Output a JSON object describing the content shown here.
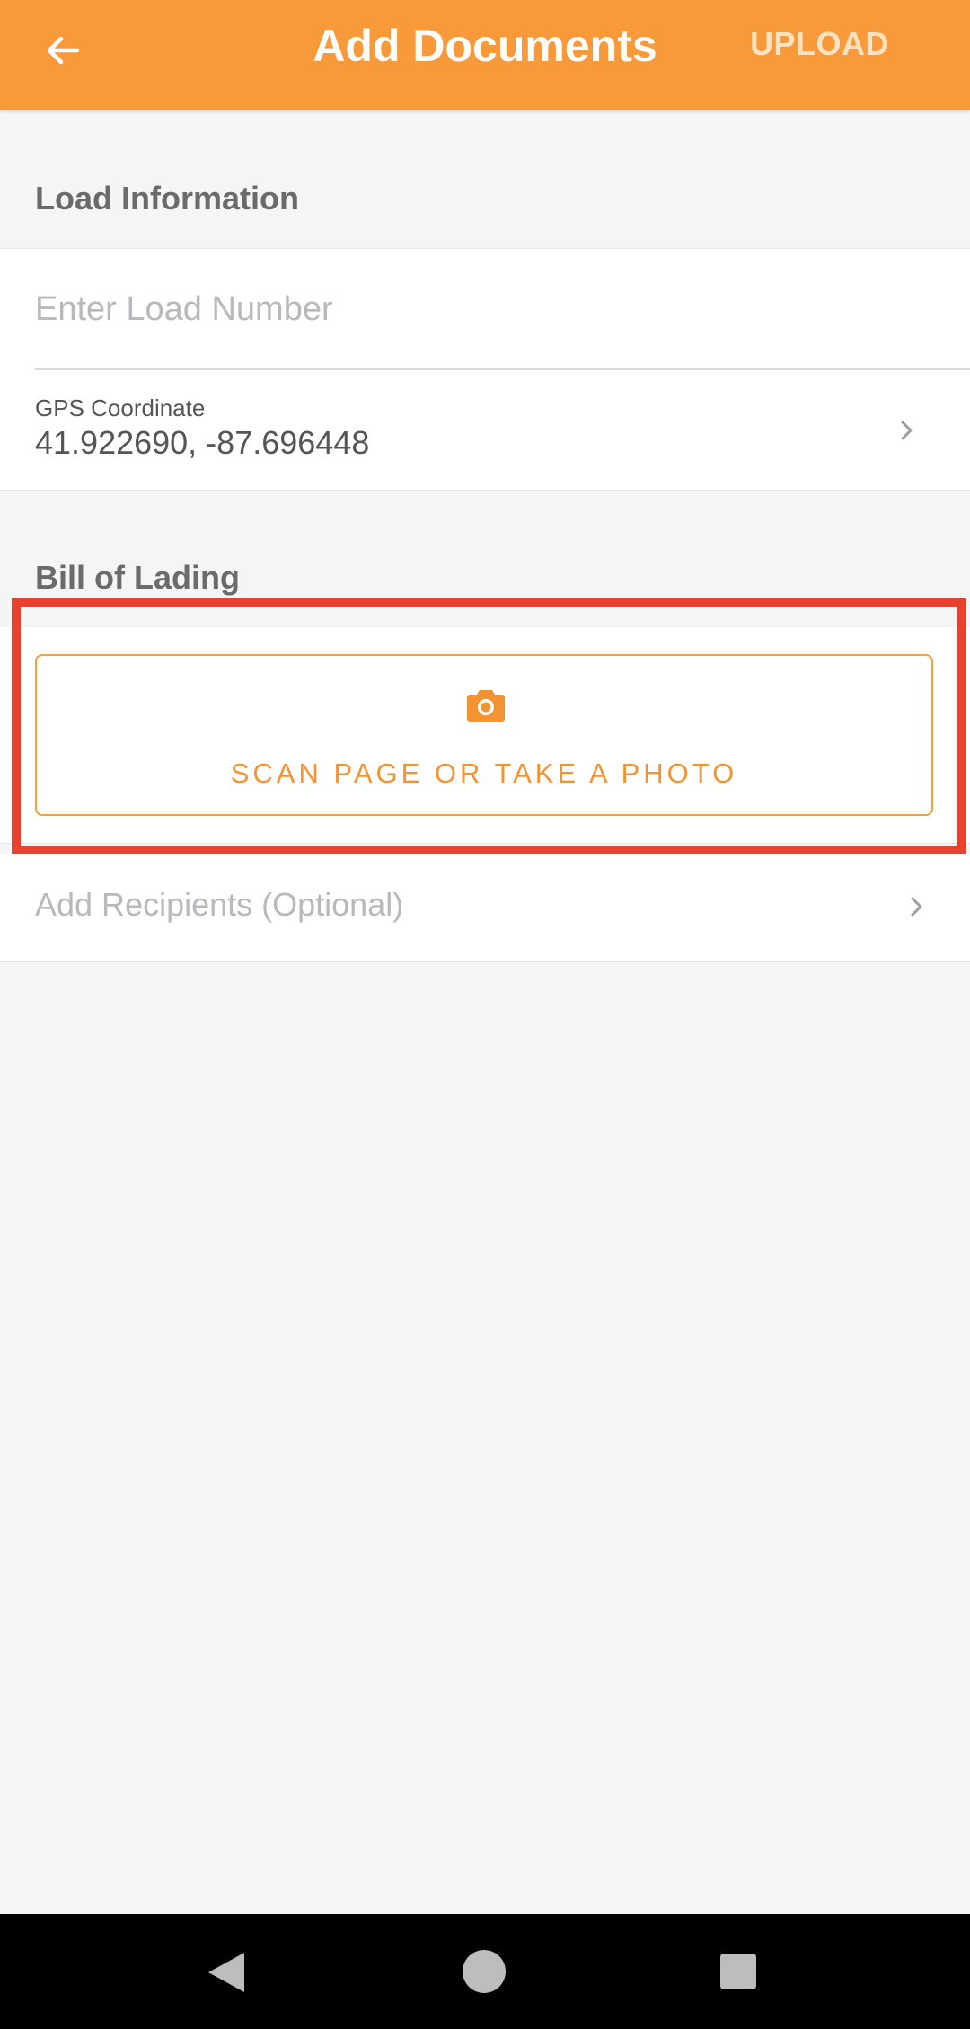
{
  "appbar": {
    "title": "Add Documents",
    "upload_label": "UPLOAD",
    "back_icon": "arrow-left-icon"
  },
  "load_info": {
    "header": "Load Information",
    "load_number_placeholder": "Enter Load Number",
    "load_number_value": "",
    "gps_label": "GPS Coordinate",
    "gps_value": "41.922690, -87.696448"
  },
  "bill_of_lading": {
    "header": "Bill of Lading",
    "scan_label": "SCAN PAGE OR TAKE A PHOTO",
    "scan_icon": "camera-icon"
  },
  "recipients": {
    "label": "Add Recipients (Optional)"
  },
  "colors": {
    "accent": "#f89a3a",
    "highlight": "#e8412e"
  }
}
